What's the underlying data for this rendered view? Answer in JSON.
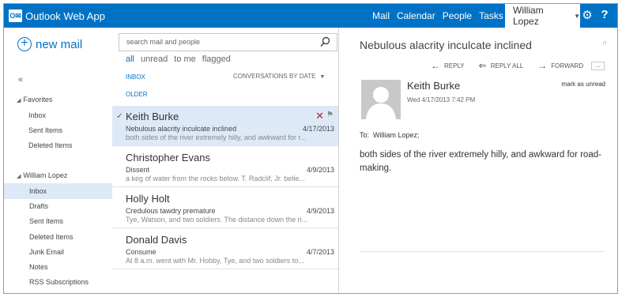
{
  "app": {
    "title": "Outlook Web App",
    "logo_text": "O✉",
    "brand_color": "#0072c6",
    "selection_color": "#dde9f7"
  },
  "topnav": {
    "items": [
      {
        "label": "Mail"
      },
      {
        "label": "Calendar"
      },
      {
        "label": "People"
      },
      {
        "label": "Tasks"
      }
    ],
    "user": "William Lopez",
    "icons": [
      "settings-gear-icon",
      "help-icon"
    ]
  },
  "leftnav": {
    "new_mail": "new mail",
    "collapse": "«",
    "favorites": {
      "header": "Favorites",
      "items": [
        "Inbox",
        "Sent Items",
        "Deleted Items"
      ]
    },
    "account": {
      "header": "William Lopez",
      "items": [
        "Inbox",
        "Drafts",
        "Sent Items",
        "Deleted Items",
        "Junk Email",
        "Notes",
        "RSS Subscriptions"
      ],
      "selected": "Inbox"
    }
  },
  "list": {
    "search_placeholder": "search mail and people",
    "filters": [
      "all",
      "unread",
      "to me",
      "flagged"
    ],
    "active_filter": "all",
    "folder": "INBOX",
    "sort": "CONVERSATIONS BY DATE",
    "group": "OLDER",
    "messages": [
      {
        "sender": "Keith Burke",
        "subject": "Nebulous alacrity inculcate inclined",
        "date": "4/17/2013",
        "preview": "both sides of the river extremely hilly, and awkward for r...",
        "selected": true
      },
      {
        "sender": "Christopher Evans",
        "subject": "Dissent",
        "date": "4/9/2013",
        "preview": "a keg of water from the rocks below. T. Radclif, Jr. belie...",
        "selected": false
      },
      {
        "sender": "Holly Holt",
        "subject": "Credulous tawdry premature",
        "date": "4/9/2013",
        "preview": "Tye, Watson, and two soldiers. The distance down the ri...",
        "selected": false
      },
      {
        "sender": "Donald Davis",
        "subject": "Consume",
        "date": "4/7/2013",
        "preview": "At 8 a.m. went with Mr. Hobby, Tye, and two soldiers to...",
        "selected": false
      }
    ]
  },
  "reading": {
    "subject": "Nebulous alacrity inculcate inclined",
    "actions": [
      "REPLY",
      "REPLY ALL",
      "FORWARD"
    ],
    "more": "...",
    "from": "Keith Burke",
    "sent": "Wed 4/17/2013 7:42 PM",
    "mark_unread": "mark as unread",
    "to_label": "To:",
    "to": "William Lopez;",
    "body": "both sides of the river extremely hilly, and awkward for road-making."
  }
}
